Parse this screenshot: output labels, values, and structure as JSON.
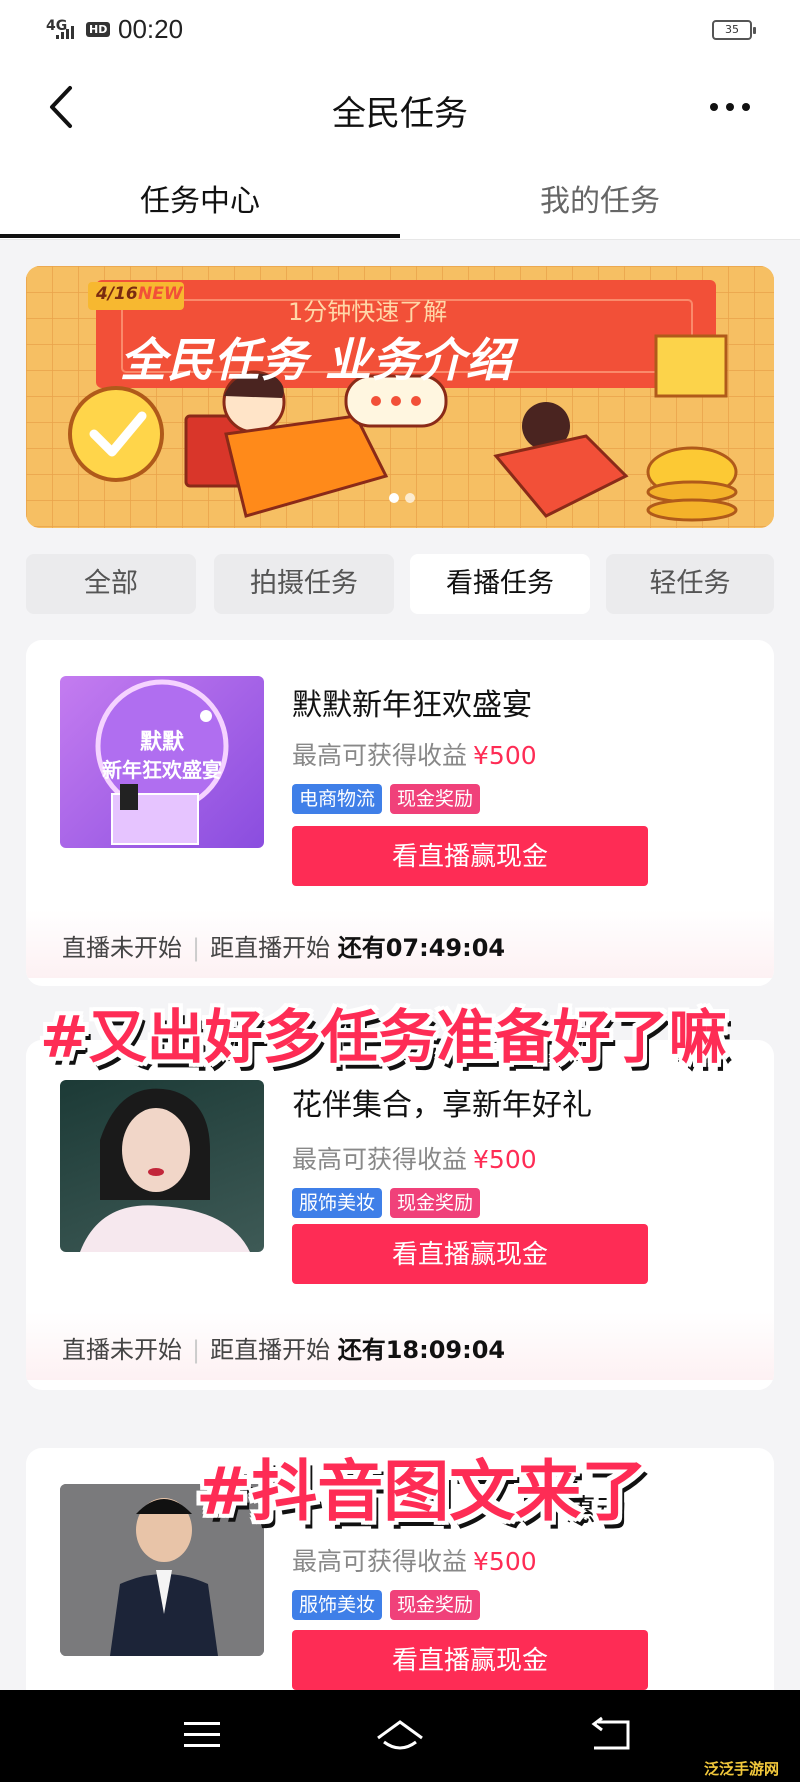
{
  "status_bar": {
    "network": "4G",
    "hd": "HD",
    "time": "00:20",
    "battery": "35"
  },
  "nav": {
    "title": "全民任务"
  },
  "tabs": [
    {
      "label": "任务中心",
      "active": true
    },
    {
      "label": "我的任务",
      "active": false
    }
  ],
  "banner": {
    "date_badge": "4/16",
    "new_badge": "NEW",
    "subtitle": "1分钟快速了解",
    "title": "全民任务 业务介绍"
  },
  "filters": [
    {
      "label": "全部",
      "active": false
    },
    {
      "label": "拍摄任务",
      "active": false
    },
    {
      "label": "看播任务",
      "active": true
    },
    {
      "label": "轻任务",
      "active": false
    }
  ],
  "tasks": [
    {
      "title": "默默新年狂欢盛宴",
      "earn_label": "最高可获得收益",
      "earn_amount": "¥500",
      "tags": [
        {
          "label": "电商物流",
          "color": "#3f7fe8"
        },
        {
          "label": "现金奖励",
          "color": "#f0417a"
        }
      ],
      "button": "看直播赢现金",
      "status": "直播未开始",
      "countdown_label": "距直播开始",
      "countdown_value": "还有07:49:04",
      "thumb_text": [
        "默默",
        "新年狂欢盛宴"
      ]
    },
    {
      "title": "花伴集合，享新年好礼",
      "earn_label": "最高可获得收益",
      "earn_amount": "¥500",
      "tags": [
        {
          "label": "服饰美妆",
          "color": "#3f7fe8"
        },
        {
          "label": "现金奖励",
          "color": "#f0417a"
        }
      ],
      "button": "看直播赢现金",
      "status": "直播未开始",
      "countdown_label": "距直播开始",
      "countdown_value": "还有18:09:04"
    },
    {
      "title": "惠动",
      "earn_label": "最高可获得收益",
      "earn_amount": "¥500",
      "tags": [
        {
          "label": "服饰美妆",
          "color": "#3f7fe8"
        },
        {
          "label": "现金奖励",
          "color": "#f0417a"
        }
      ],
      "button": "看直播赢现金"
    }
  ],
  "overlays": {
    "caption1": "#又出好多任务准备好了嘛",
    "caption2": "#抖音图文来了"
  },
  "watermark": "泛泛手游网"
}
